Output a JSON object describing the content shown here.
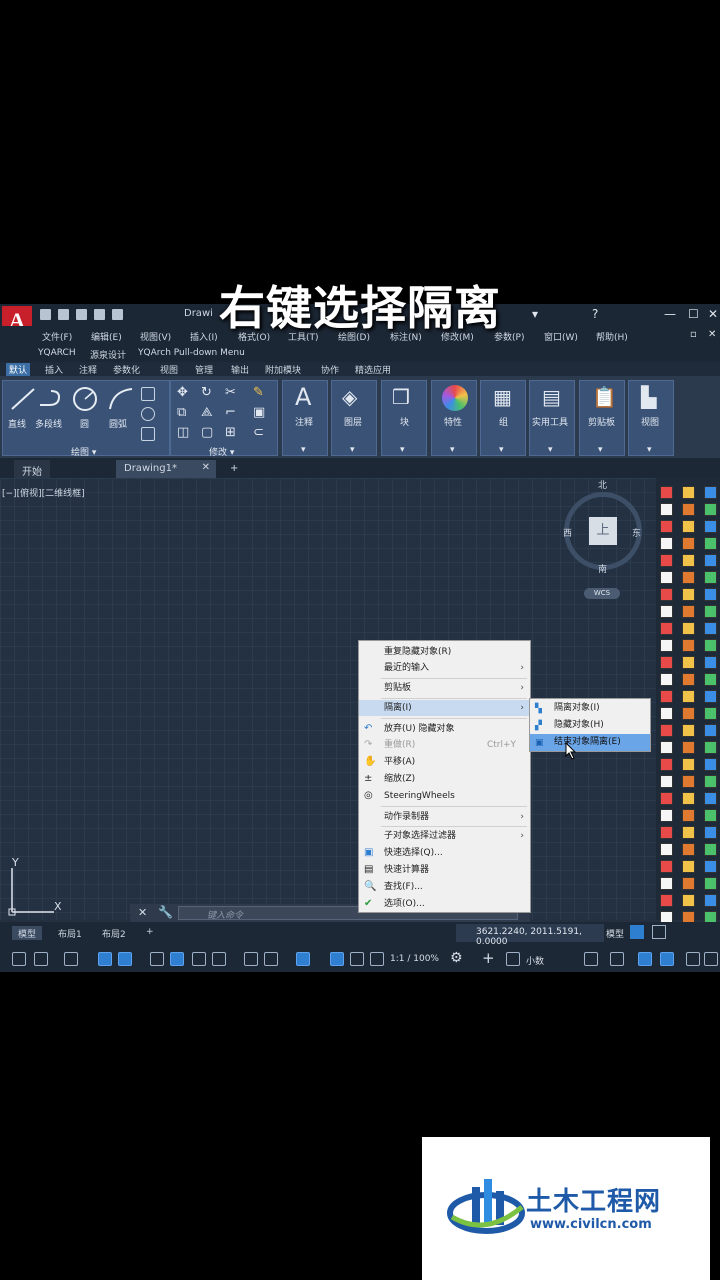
{
  "caption": "右键选择隔离",
  "app": {
    "title": "Drawi",
    "logo": "A",
    "menus": [
      "文件(F)",
      "编辑(E)",
      "视图(V)",
      "插入(I)",
      "格式(O)",
      "工具(T)",
      "绘图(D)",
      "标注(N)",
      "修改(M)",
      "参数(P)",
      "窗口(W)",
      "帮助(H)"
    ],
    "yq_menus": [
      "YQARCH",
      "源泉设计",
      "YQArch Pull-down Menu"
    ],
    "ribbon_tabs": [
      "默认",
      "插入",
      "注释",
      "参数化",
      "视图",
      "管理",
      "输出",
      "附加模块",
      "协作",
      "精选应用"
    ],
    "ribbon_tools": [
      "直线",
      "多段线",
      "圆",
      "圆弧"
    ],
    "panel_draw": "绘图 ▾",
    "panel_modify": "修改 ▾",
    "ribbon_big": [
      "注释",
      "图层",
      "块",
      "特性",
      "组",
      "实用工具",
      "剪贴板",
      "视图"
    ],
    "file_tabs": {
      "start": "开始",
      "drawing": "Drawing1*"
    },
    "view_label": "[−][俯视][二维线框]",
    "viewcube": {
      "north": "北",
      "south": "南",
      "east": "东",
      "west": "西",
      "top": "上",
      "wcs": "WCS"
    },
    "ucs": {
      "x": "X",
      "y": "Y"
    },
    "command_placeholder": "键入命令"
  },
  "context_menu": {
    "items": [
      {
        "label": "重复隐藏对象(R)"
      },
      {
        "label": "最近的输入",
        "arrow": "›"
      },
      {
        "label": "剪贴板",
        "arrow": "›"
      },
      {
        "label": "隔离(I)",
        "arrow": "›"
      },
      {
        "label": "放弃(U) 隐藏对象"
      },
      {
        "label": "重做(R)",
        "shortcut": "Ctrl+Y"
      },
      {
        "label": "平移(A)"
      },
      {
        "label": "缩放(Z)"
      },
      {
        "label": "SteeringWheels"
      },
      {
        "label": "动作录制器",
        "arrow": "›"
      },
      {
        "label": "子对象选择过滤器",
        "arrow": "›"
      },
      {
        "label": "快速选择(Q)..."
      },
      {
        "label": "快速计算器"
      },
      {
        "label": "查找(F)..."
      },
      {
        "label": "选项(O)..."
      }
    ]
  },
  "submenu": {
    "items": [
      {
        "label": "隔离对象(I)"
      },
      {
        "label": "隐藏对象(H)"
      },
      {
        "label": "结束对象隔离(E)"
      }
    ]
  },
  "statusbar": {
    "layouts": [
      "模型",
      "布局1",
      "布局2"
    ],
    "coords": "3621.2240, 2011.5191, 0.0000",
    "model": "模型",
    "scale": "1:1 / 100%",
    "units": "小数"
  },
  "watermark": {
    "name": "土木工程网",
    "url": "www.civilcn.com"
  },
  "colors": {
    "accent": "#2f7fd1",
    "highlight": "#6aa5e8",
    "logo_red": "#c8202a"
  }
}
